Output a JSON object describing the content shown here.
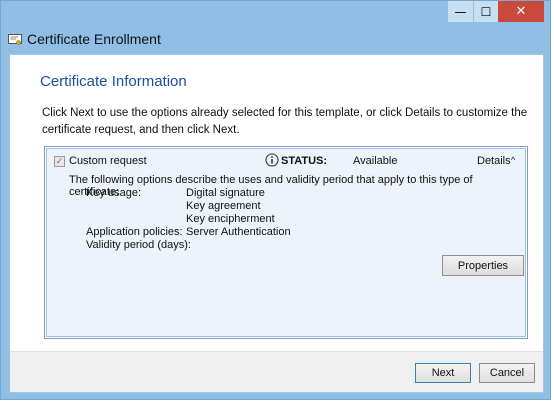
{
  "window": {
    "title": "Certificate Enrollment",
    "controls": {
      "minimize": "—",
      "maximize": "☐",
      "close": "✕"
    }
  },
  "page": {
    "heading": "Certificate Information",
    "intro": "Click Next to use the options already selected for this template, or click Details to customize the certificate request, and then click Next."
  },
  "template": {
    "name": "Custom request",
    "checked": true,
    "status_label": "STATUS:",
    "status_value": "Available",
    "details_label": "Details",
    "details_chevron": "^",
    "description": "The following options describe the uses and validity period that apply to this type of certificate:",
    "key_usage_label": "Key usage:",
    "key_usage_values": [
      "Digital signature",
      "Key agreement",
      "Key encipherment"
    ],
    "app_policies_label": "Application policies:",
    "app_policies_value": "Server Authentication",
    "validity_label": "Validity period (days):",
    "validity_value": "",
    "properties_label": "Properties"
  },
  "footer": {
    "next_label": "Next",
    "cancel_label": "Cancel"
  },
  "icons": {
    "app": "certificate-icon",
    "status": "info-icon"
  }
}
